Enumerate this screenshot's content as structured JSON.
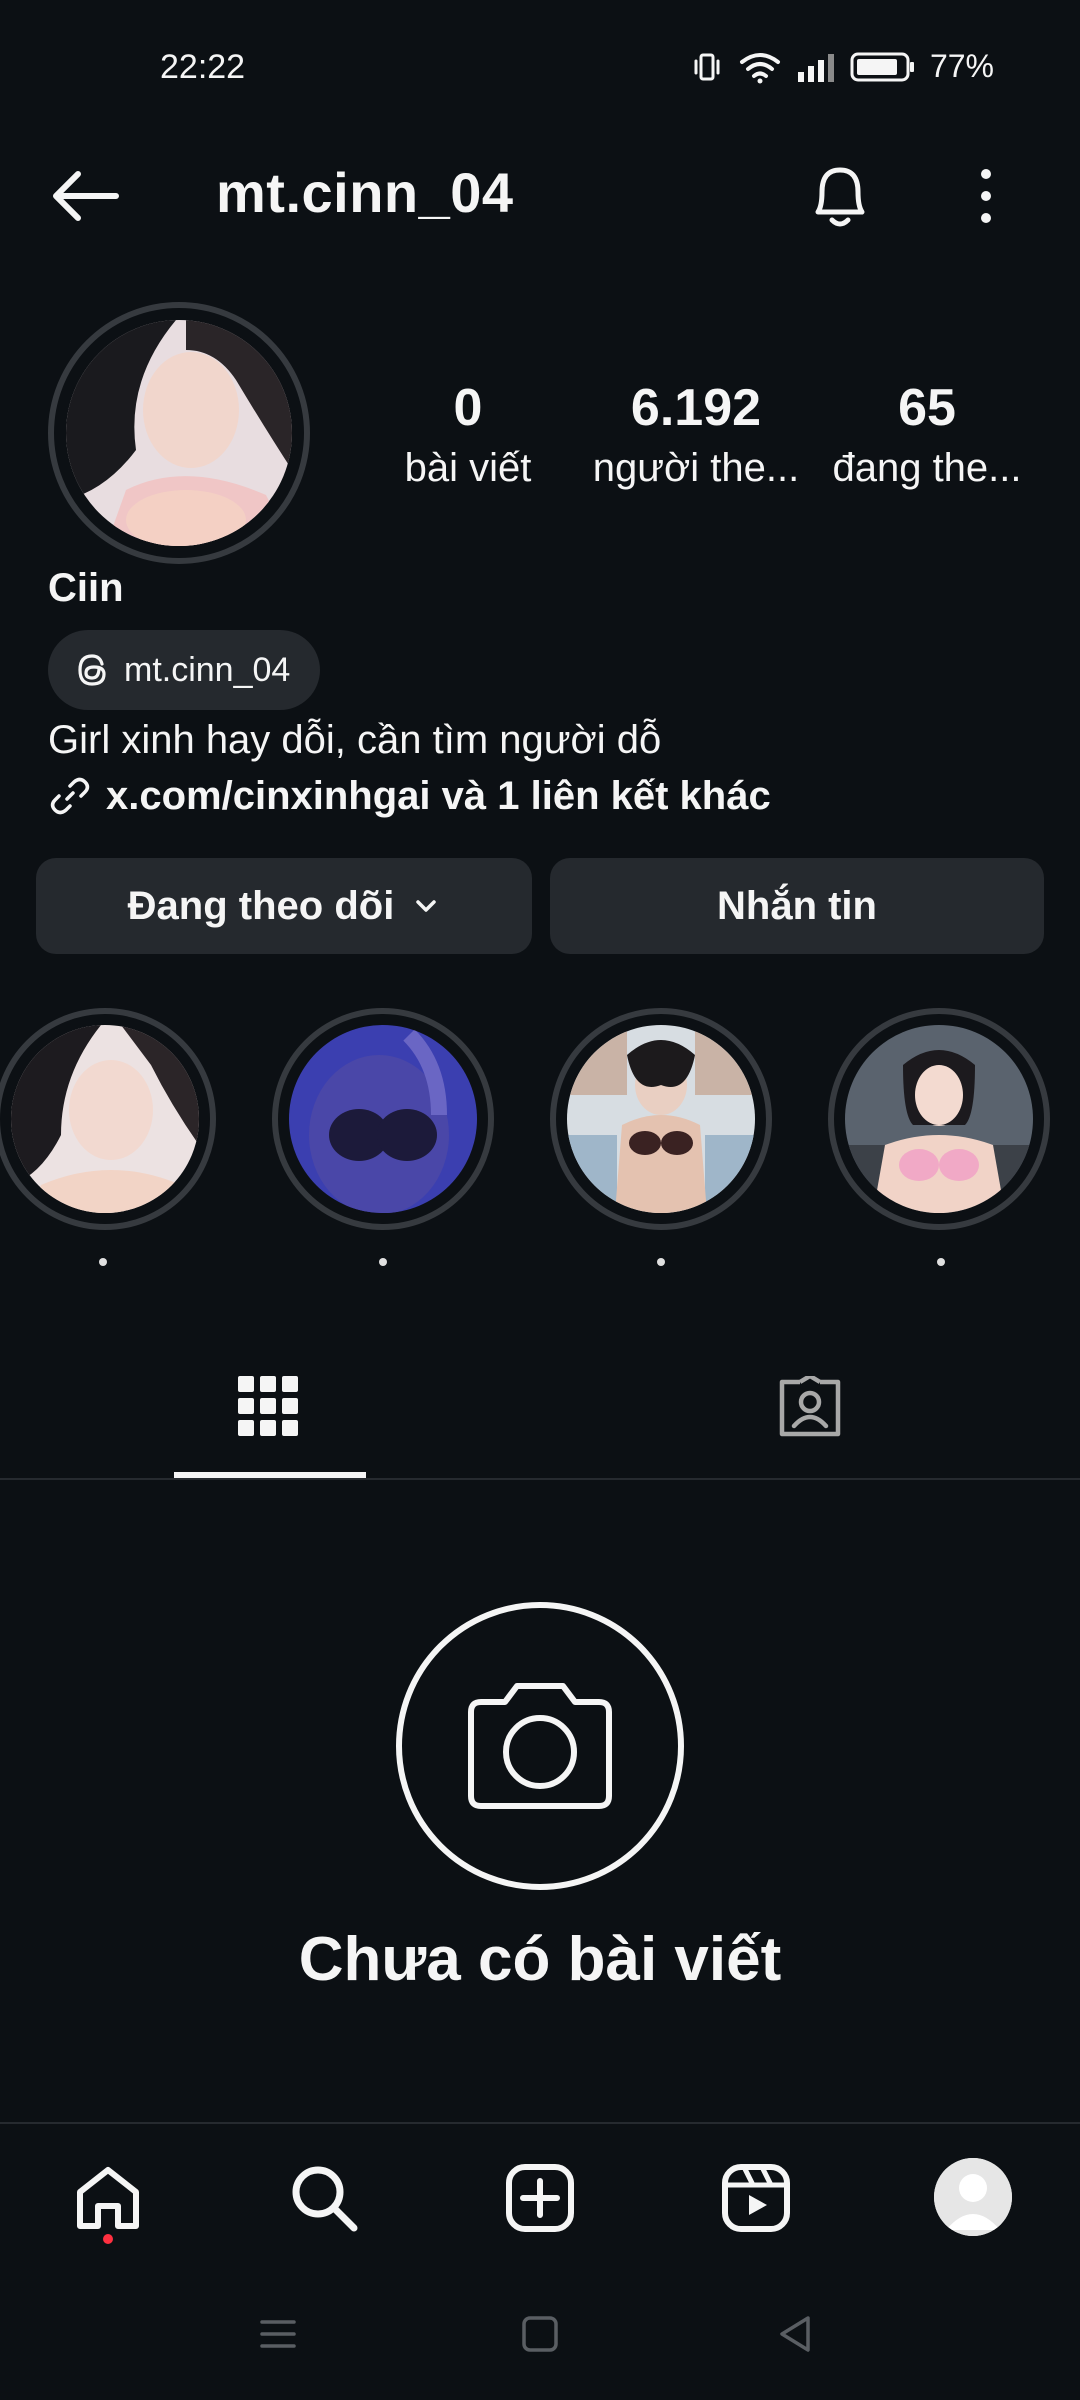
{
  "status_bar": {
    "time": "22:22",
    "battery": "77%",
    "icons": [
      "vibrate-icon",
      "wifi-icon",
      "signal-icon",
      "battery-icon"
    ]
  },
  "header": {
    "username": "mt.cinn_04",
    "icons": [
      "back-arrow-icon",
      "bell-icon",
      "more-vertical-icon"
    ]
  },
  "profile": {
    "stats": [
      {
        "value": "0",
        "label": "bài viết"
      },
      {
        "value": "6.192",
        "label": "người the..."
      },
      {
        "value": "65",
        "label": "đang the..."
      }
    ],
    "display_name": "Ciin",
    "threads_handle": "mt.cinn_04",
    "bio": "Girl xinh hay dỗi, cần tìm người dỗ",
    "link_text": "x.com/cinxinhgai và 1 liên kết khác"
  },
  "actions": {
    "following_label": "Đang theo dõi",
    "message_label": "Nhắn tin"
  },
  "highlights": [
    {
      "label": "."
    },
    {
      "label": "."
    },
    {
      "label": "."
    },
    {
      "label": "."
    }
  ],
  "tabs": [
    "grid-icon",
    "tagged-icon"
  ],
  "empty_state": {
    "title": "Chưa có bài viết"
  },
  "bottom_nav": [
    "home-icon",
    "search-icon",
    "create-icon",
    "reels-icon",
    "profile-avatar"
  ],
  "colors": {
    "background": "#0c1014",
    "button": "#25292e",
    "text": "#f5f5f5",
    "notification_dot": "#ff3040"
  }
}
